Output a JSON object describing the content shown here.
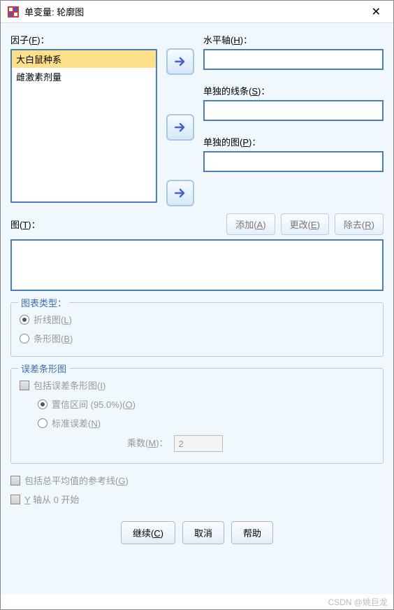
{
  "window": {
    "title": "单变量:  轮廓图",
    "close_glyph": "✕"
  },
  "factors": {
    "label_pre": "因子(",
    "label_key": "F",
    "label_post": ")：",
    "items": [
      "大白鼠种系",
      "雌激素剂量"
    ],
    "selected_index": 0
  },
  "targets": {
    "horizontal": {
      "label_pre": "水平轴(",
      "label_key": "H",
      "label_post": ")："
    },
    "lines": {
      "label_pre": "单独的线条(",
      "label_key": "S",
      "label_post": ")："
    },
    "plots": {
      "label_pre": "单独的图(",
      "label_key": "P",
      "label_post": ")："
    }
  },
  "plots_section": {
    "label_pre": "图(",
    "label_key": "T",
    "label_post": ")：",
    "add": {
      "pre": "添加(",
      "key": "A",
      "post": ")"
    },
    "change": {
      "pre": "更改(",
      "key": "E",
      "post": ")"
    },
    "remove": {
      "pre": "除去(",
      "key": "R",
      "post": ")"
    }
  },
  "chart_type": {
    "legend": "图表类型：",
    "line": {
      "pre": "折线图(",
      "key": "L",
      "post": ")"
    },
    "bar": {
      "pre": "条形图(",
      "key": "B",
      "post": ")"
    }
  },
  "error_bars": {
    "legend": "误差条形图",
    "include": {
      "pre": "包括误差条形图(",
      "key": "I",
      "post": ")"
    },
    "ci": {
      "pre": "置信区间 (95.0%)(",
      "key": "O",
      "post": ")"
    },
    "se": {
      "pre": "标准误差(",
      "key": "N",
      "post": ")"
    },
    "mult_label": {
      "pre": "乘数(",
      "key": "M",
      "post": ")："
    },
    "mult_value": "2"
  },
  "extras": {
    "refline": {
      "pre": "包括总平均值的参考线(",
      "key": "G",
      "post": ")"
    },
    "yzero": {
      "pre_underline": "Y",
      "rest": " 轴从 0 开始"
    }
  },
  "buttons": {
    "continue": {
      "pre": "继续(",
      "key": "C",
      "post": ")"
    },
    "cancel": "取消",
    "help": "帮助"
  },
  "watermark": "CSDN @姚巨龙"
}
